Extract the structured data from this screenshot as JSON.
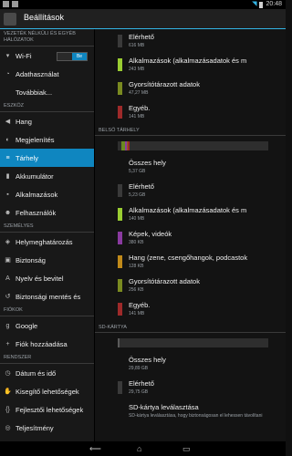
{
  "status": {
    "time": "20:48"
  },
  "actionbar": {
    "title": "Beállítások"
  },
  "sidebar": {
    "sections": [
      {
        "title": "VEZETÉK NÉLKÜLI ÉS EGYÉB HÁLÓZATOK",
        "items": [
          {
            "label": "Wi-Fi",
            "icon": "wifi-icon",
            "glyph": "▾",
            "toggle": "Be"
          },
          {
            "label": "Adathasználat",
            "icon": "data-usage-icon",
            "glyph": "◔"
          },
          {
            "label": "Továbbiak...",
            "icon": "",
            "glyph": ""
          }
        ]
      },
      {
        "title": "ESZKÖZ",
        "items": [
          {
            "label": "Hang",
            "icon": "sound-icon",
            "glyph": "◀"
          },
          {
            "label": "Megjelenítés",
            "icon": "display-icon",
            "glyph": "◐"
          },
          {
            "label": "Tárhely",
            "icon": "storage-icon",
            "glyph": "≡",
            "selected": true
          },
          {
            "label": "Akkumulátor",
            "icon": "battery-icon",
            "glyph": "▮"
          },
          {
            "label": "Alkalmazások",
            "icon": "apps-icon",
            "glyph": "▪"
          },
          {
            "label": "Felhasználók",
            "icon": "users-icon",
            "glyph": "☻"
          }
        ]
      },
      {
        "title": "SZEMÉLYES",
        "items": [
          {
            "label": "Helymeghatározás",
            "icon": "location-icon",
            "glyph": "◈"
          },
          {
            "label": "Biztonság",
            "icon": "lock-icon",
            "glyph": "▣"
          },
          {
            "label": "Nyelv és bevitel",
            "icon": "language-icon",
            "glyph": "A"
          },
          {
            "label": "Biztonsági mentés és",
            "icon": "backup-icon",
            "glyph": "↺"
          }
        ]
      },
      {
        "title": "FIÓKOK",
        "items": [
          {
            "label": "Google",
            "icon": "google-icon",
            "glyph": "g"
          },
          {
            "label": "Fiók hozzáadása",
            "icon": "add-icon",
            "glyph": "+"
          }
        ]
      },
      {
        "title": "RENDSZER",
        "items": [
          {
            "label": "Dátum és idő",
            "icon": "clock-icon",
            "glyph": "◷"
          },
          {
            "label": "Kisegítő lehetőségek",
            "icon": "hand-icon",
            "glyph": "✋"
          },
          {
            "label": "Fejlesztői lehetőségek",
            "icon": "developer-icon",
            "glyph": "{}"
          },
          {
            "label": "Teljesítmény",
            "icon": "performance-icon",
            "glyph": "◎"
          }
        ]
      }
    ]
  },
  "main": {
    "top_rows": [
      {
        "label": "Elérhető",
        "sub": "616 MB",
        "color": "#3a3a3a"
      },
      {
        "label": "Alkalmazások (alkalmazásadatok és m",
        "sub": "243 MB",
        "color": "#9acd32"
      },
      {
        "label": "Gyorsítótárazott adatok",
        "sub": "47,27 MB",
        "color": "#7a8a20"
      },
      {
        "label": "Egyéb.",
        "sub": "141 MB",
        "color": "#9e2a2a"
      }
    ],
    "internal": {
      "title": "BELSŐ TÁRHELY",
      "bar": [
        {
          "color": "#2e2e2e",
          "fraction": 0.025
        },
        {
          "color": "#6a8a20",
          "fraction": 0.025
        },
        {
          "color": "#8a3aa0",
          "fraction": 0.008
        },
        {
          "color": "#8a6a20",
          "fraction": 0.006
        },
        {
          "color": "#9e2a2a",
          "fraction": 0.012
        }
      ],
      "rows": [
        {
          "label": "Összes hely",
          "sub": "5,37 GB",
          "color": ""
        },
        {
          "label": "Elérhető",
          "sub": "5,23 GB",
          "color": "#3a3a3a"
        },
        {
          "label": "Alkalmazások (alkalmazásadatok és m",
          "sub": "140 MB",
          "color": "#9acd32"
        },
        {
          "label": "Képek, videók",
          "sub": "380 KB",
          "color": "#8a3aa0"
        },
        {
          "label": "Hang (zene, csengőhangok, podcastok",
          "sub": "128 KB",
          "color": "#c08a1a"
        },
        {
          "label": "Gyorsítótárazott adatok",
          "sub": "256 KB",
          "color": "#7a8a20"
        },
        {
          "label": "Egyéb.",
          "sub": "141 MB",
          "color": "#9e2a2a"
        }
      ]
    },
    "sd": {
      "title": "SD-KÁRTYA",
      "used_fraction": 0.01,
      "rows": [
        {
          "label": "Összes hely",
          "sub": "29,89 GB",
          "color": ""
        },
        {
          "label": "Elérhető",
          "sub": "29,75 GB",
          "color": "#3a3a3a"
        },
        {
          "label": "SD-kártya leválasztása",
          "sub": "SD-kártya leválasztása, hogy biztonságosan el lehessen távolítani",
          "color": ""
        }
      ]
    }
  }
}
